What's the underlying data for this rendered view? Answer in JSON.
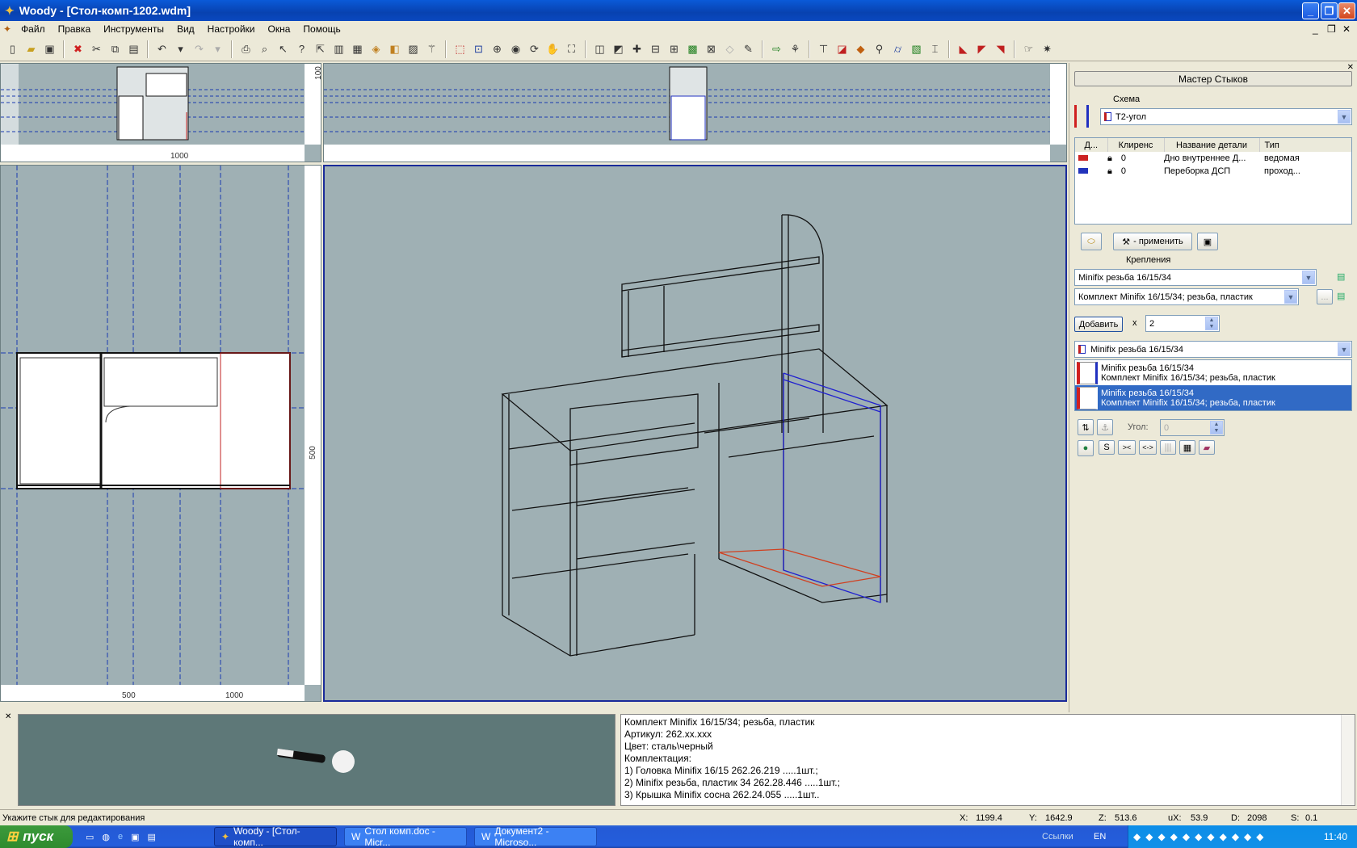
{
  "window": {
    "title": "Woody - [Стол-комп-1202.wdm]",
    "controls": [
      "_",
      "❐",
      "✕"
    ]
  },
  "menu": [
    "Файл",
    "Правка",
    "Инструменты",
    "Вид",
    "Настройки",
    "Окна",
    "Помощь"
  ],
  "views": {
    "top_left_ruler_label": "1000",
    "top_left_side_label": "100",
    "left_ruler_500": "500",
    "left_ruler_1000": "1000",
    "left_side_500": "500"
  },
  "panel": {
    "title": "Мастер Стыков",
    "schema_label": "Схема",
    "schema_value": "Т2-угол",
    "table_headers": [
      "Д...",
      "Клиренс",
      "Название детали",
      "Тип"
    ],
    "rows": [
      {
        "clearance": "0",
        "name": "Дно внутреннее Д...",
        "type": "ведомая",
        "color": "#cc2222"
      },
      {
        "clearance": "0",
        "name": "Переборка ДСП",
        "type": "проход...",
        "color": "#2233bb"
      }
    ],
    "apply_label": "- применить",
    "fasteners_label": "Крепления",
    "fastener_type": "Minifix резьба 16/15/34",
    "fastener_kit": "Комплект Minifix 16/15/34; резьба, пластик",
    "add_label": "Добавить",
    "times": "x",
    "quantity": "2",
    "selected_combo": "Minifix резьба 16/15/34",
    "list": [
      {
        "line1": "Minifix резьба 16/15/34",
        "line2": "Комплект Minifix 16/15/34; резьба, пластик",
        "selected": false
      },
      {
        "line1": "Minifix резьба 16/15/34",
        "line2": "Комплект Minifix 16/15/34; резьба, пластик",
        "selected": true
      }
    ],
    "angle_label": "Угол:",
    "angle_value": "0",
    "tool_s": "S",
    "tool_in": "><",
    "tool_out": "<->"
  },
  "info": [
    "Комплект Minifix 16/15/34; резьба, пластик",
    "Артикул: 262.xx.xxx",
    "Цвет: сталь\\черный",
    "Комплектация:",
    "1) Головка Minifix 16/15 262.26.219 .....1шт.;",
    "2) Minifix резьба, пластик 34 262.28.446 .....1шт.;",
    "3) Крышка Minifix сосна 262.24.055 .....1шт.."
  ],
  "status": {
    "hint": "Укажите стык для редактирования",
    "x": "X:",
    "x_val": "1199.4",
    "y": "Y:",
    "y_val": "1642.9",
    "z": "Z:",
    "z_val": "513.6",
    "ux": "uX:",
    "ux_val": "53.9",
    "d": "D:",
    "d_val": "2098",
    "s": "S:",
    "s_val": "0.1"
  },
  "taskbar": {
    "start": "пуск",
    "tasks": [
      "Woody - [Стол-комп...",
      "Стол комп.doc - Micr...",
      "Документ2 - Microso..."
    ],
    "links": "Ссылки",
    "lang": "EN",
    "clock": "11:40"
  }
}
